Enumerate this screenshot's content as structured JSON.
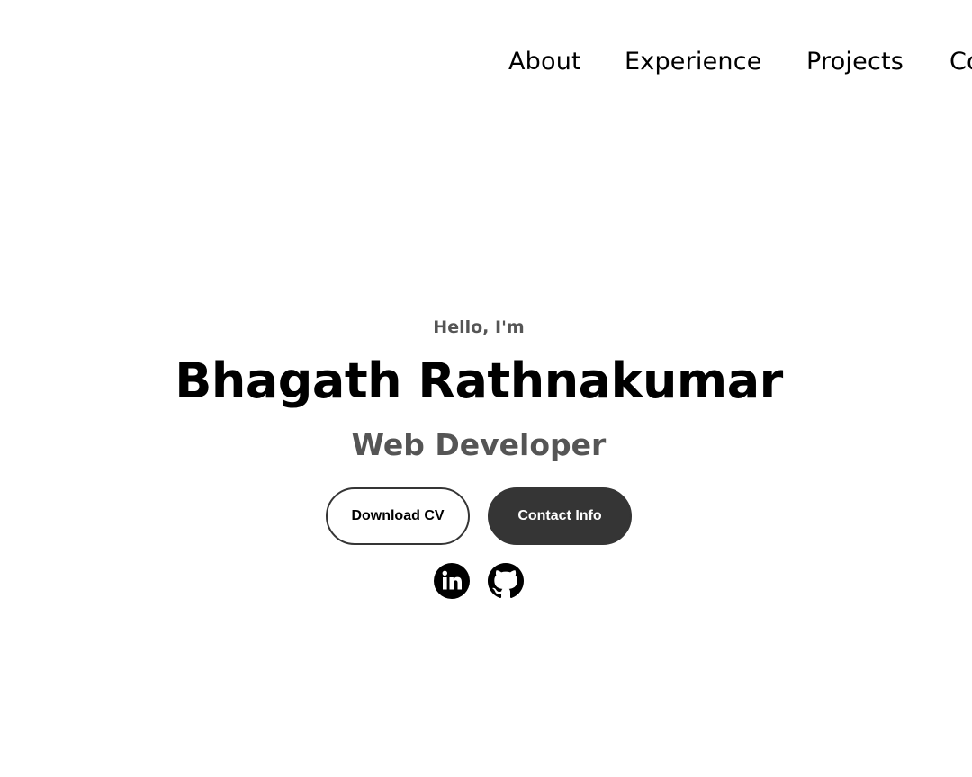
{
  "nav": {
    "items": [
      {
        "label": "About"
      },
      {
        "label": "Experience"
      },
      {
        "label": "Projects"
      },
      {
        "label": "Co"
      }
    ]
  },
  "hero": {
    "greeting": "Hello, I'm",
    "name": "Bhagath Rathnakumar",
    "role": "Web Developer",
    "download_cv_label": "Download CV",
    "contact_info_label": "Contact Info"
  },
  "social": {
    "linkedin_icon": "linkedin-icon",
    "github_icon": "github-icon"
  },
  "colors": {
    "text": "#000000",
    "muted": "#555555",
    "dark_button": "#353535",
    "background": "#ffffff"
  }
}
